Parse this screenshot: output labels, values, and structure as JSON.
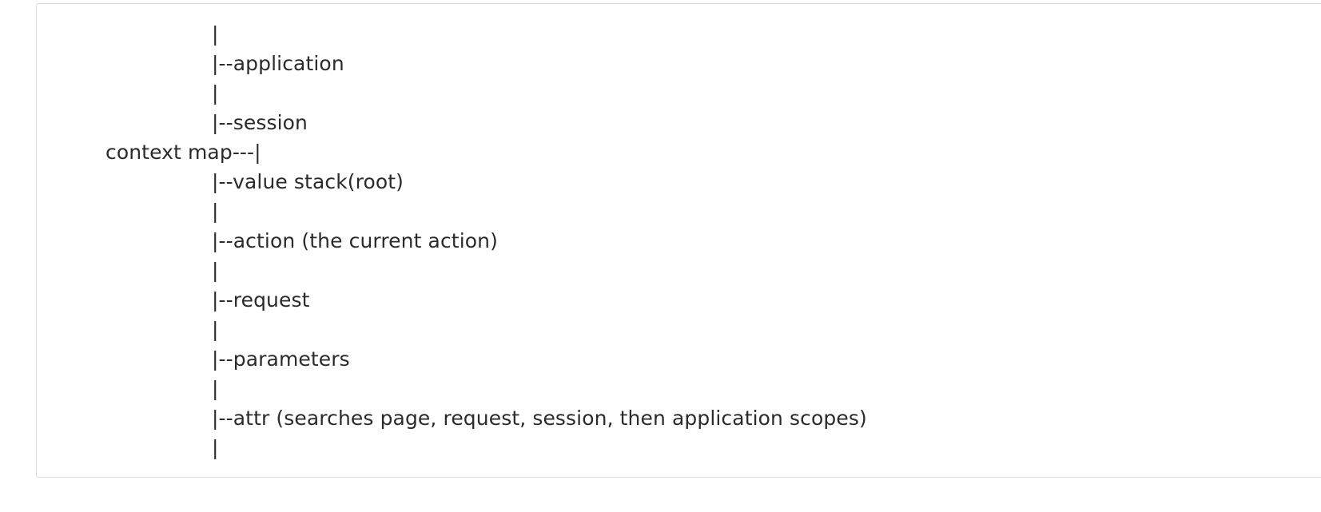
{
  "code_block": {
    "lines": [
      {
        "indent": "branch",
        "text": "|"
      },
      {
        "indent": "branch",
        "text": "|--application"
      },
      {
        "indent": "branch",
        "text": "|"
      },
      {
        "indent": "branch",
        "text": "|--session"
      },
      {
        "indent": "root",
        "text": "context map---|"
      },
      {
        "indent": "branch",
        "text": "|--value stack(root)"
      },
      {
        "indent": "branch",
        "text": "|"
      },
      {
        "indent": "branch",
        "text": "|--action (the current action)"
      },
      {
        "indent": "branch",
        "text": "|"
      },
      {
        "indent": "branch",
        "text": "|--request"
      },
      {
        "indent": "branch",
        "text": "|"
      },
      {
        "indent": "branch",
        "text": "|--parameters"
      },
      {
        "indent": "branch",
        "text": "|"
      },
      {
        "indent": "branch",
        "text": "|--attr (searches page, request, session, then application scopes)"
      },
      {
        "indent": "branch",
        "text": "|"
      }
    ]
  }
}
